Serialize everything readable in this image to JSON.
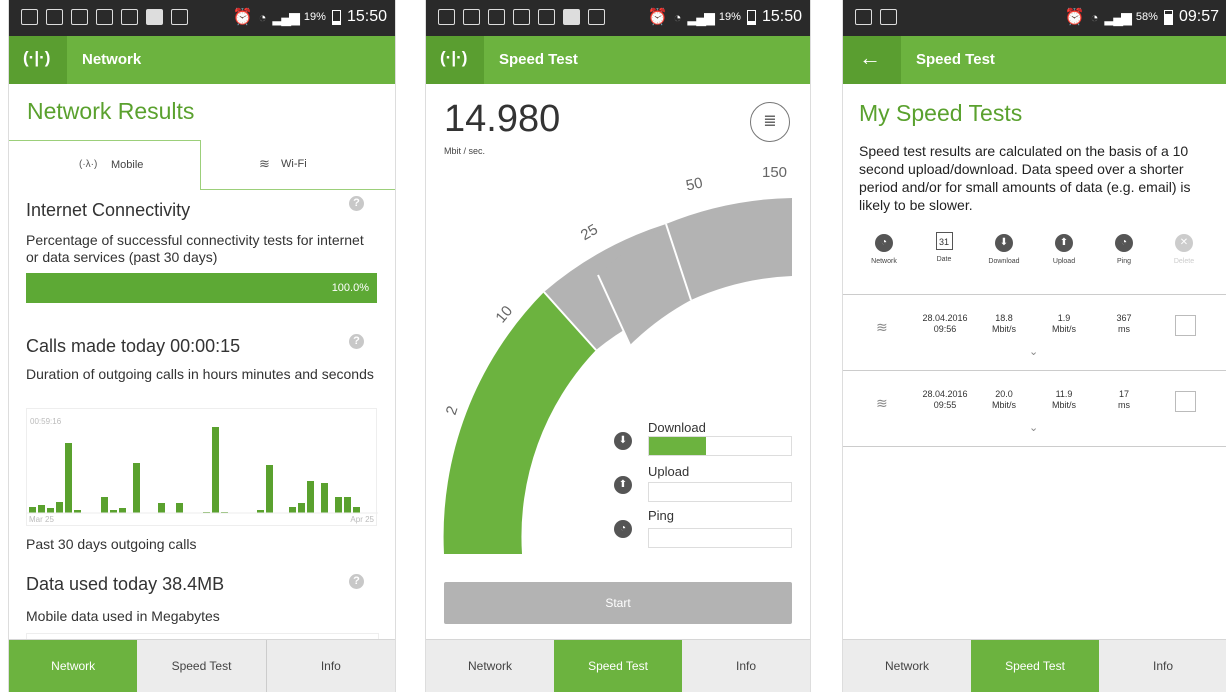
{
  "screens": [
    {
      "status": {
        "battery": "19%",
        "time": "15:50"
      },
      "header": {
        "title": "Network",
        "icon": "antenna-icon"
      },
      "page_title": "Network Results",
      "tabs": [
        {
          "label": "Mobile",
          "icon": "antenna-icon",
          "active": true
        },
        {
          "label": "Wi-Fi",
          "icon": "wifi-icon",
          "active": false
        }
      ],
      "connectivity": {
        "title": "Internet Connectivity",
        "description": "Percentage of successful connectivity tests for internet or data services (past 30 days)",
        "progress_label": "100.0%",
        "progress": 1.0
      },
      "calls": {
        "title": "Calls made today 00:00:15",
        "description": "Duration of outgoing calls in hours minutes and seconds",
        "y_max_label": "00:59:16",
        "x_start_label": "Mar 25",
        "x_end_label": "Apr 25",
        "caption": "Past 30 days outgoing calls"
      },
      "data_used": {
        "title": "Data used today 38.4MB",
        "description": "Mobile data used in Megabytes"
      },
      "nav": [
        "Network",
        "Speed Test",
        "Info"
      ],
      "nav_active": 0
    },
    {
      "status": {
        "battery": "19%",
        "time": "15:50"
      },
      "header": {
        "title": "Speed Test",
        "icon": "antenna-icon"
      },
      "speed": {
        "value": "14.980",
        "unit": "Mbit / sec."
      },
      "gauge": {
        "ticks": [
          "2",
          "10",
          "25",
          "50",
          "150"
        ]
      },
      "metrics": [
        {
          "label": "Download",
          "icon": "download-icon",
          "fill": 0.4
        },
        {
          "label": "Upload",
          "icon": "upload-icon",
          "fill": 0
        },
        {
          "label": "Ping",
          "icon": "ping-icon",
          "fill": 0
        }
      ],
      "start_label": "Start",
      "nav": [
        "Network",
        "Speed Test",
        "Info"
      ],
      "nav_active": 1
    },
    {
      "status": {
        "battery": "58%",
        "time": "09:57"
      },
      "header": {
        "title": "Speed Test"
      },
      "page_title": "My Speed Tests",
      "description": "Speed test results are calculated on the basis of a 10 second upload/download. Data speed over a shorter period and/or for small amounts of data (e.g. email) is likely to be slower.",
      "columns": [
        {
          "label": "Network",
          "icon": "globe-icon"
        },
        {
          "label": "Date",
          "icon": "calendar-icon",
          "glyph": "31"
        },
        {
          "label": "Download",
          "icon": "download-icon"
        },
        {
          "label": "Upload",
          "icon": "upload-icon"
        },
        {
          "label": "Ping",
          "icon": "ping-icon"
        },
        {
          "label": "Delete",
          "icon": "delete-icon"
        }
      ],
      "rows": [
        {
          "date": "28.04.2016",
          "time": "09:56",
          "download": "18.8",
          "download_unit": "Mbit/s",
          "upload": "1.9",
          "upload_unit": "Mbit/s",
          "ping": "367",
          "ping_unit": "ms"
        },
        {
          "date": "28.04.2016",
          "time": "09:55",
          "download": "20.0",
          "download_unit": "Mbit/s",
          "upload": "11.9",
          "upload_unit": "Mbit/s",
          "ping": "17",
          "ping_unit": "ms"
        }
      ],
      "nav": [
        "Network",
        "Speed Test",
        "Info"
      ],
      "nav_active": 1
    }
  ],
  "colors": {
    "brand_green": "#6cb33f",
    "dark_green": "#5a9e30",
    "gauge_grey": "#b3b3b3",
    "statusbar": "#2a2a2a"
  }
}
